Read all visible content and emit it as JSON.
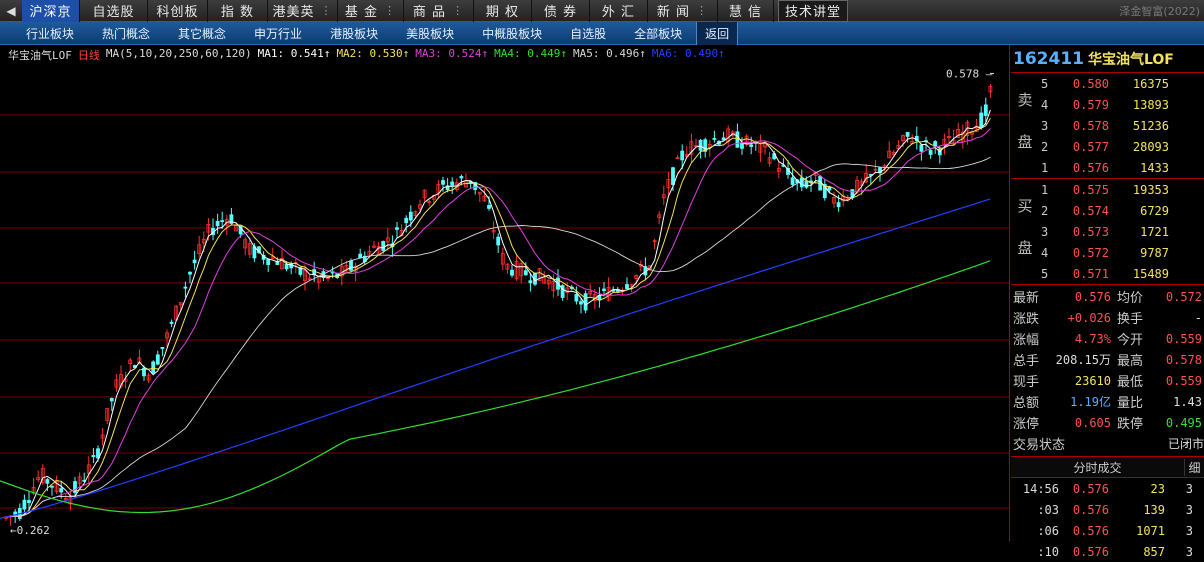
{
  "top_menu": {
    "active": "沪深京",
    "items": [
      "自选股",
      "科创板",
      "指 数",
      "港美英",
      "基 金",
      "商 品",
      "期 权",
      "债 券",
      "外 汇",
      "新 闻",
      "慧 信"
    ],
    "edu": "技术讲堂",
    "right_text": "泽金智富(2022)"
  },
  "sub_menu": {
    "items": [
      "行业板块",
      "热门概念",
      "其它概念",
      "申万行业",
      "港股板块",
      "美股板块",
      "中概股板块",
      "自选股",
      "全部板块"
    ],
    "back": "返回"
  },
  "legend": {
    "name": "华宝油气LOF",
    "period": "日线",
    "ma_params": "MA(5,10,20,250,60,120)",
    "ma1": "MA1: 0.541↑",
    "ma2": "MA2: 0.530↑",
    "ma3": "MA3: 0.524↑",
    "ma4": "MA4: 0.449↑",
    "ma5": "MA5: 0.496↑",
    "ma6": "MA6: 0.490↑"
  },
  "colors": {
    "up": "#ff3030",
    "down": "#54ffff",
    "ma1": "#ffffff",
    "ma2": "#f3e35a",
    "ma3": "#e040e0",
    "ma4": "#30e030",
    "ma5": "#d8d8d8",
    "ma6": "#2040ff",
    "grid": "#7a0000"
  },
  "chart_data": {
    "type": "candlestick",
    "y_range": [
      0.255,
      0.588
    ],
    "high_label": "0.578",
    "low_label": "0.262",
    "ma4_start": 0.296,
    "ma4_end": 0.449,
    "ma6_start": 0.27,
    "ma6_end": 0.49
  },
  "panel": {
    "code": "162411",
    "name": "华宝油气LOF",
    "sell_label": "卖盘",
    "buy_label": "买盘",
    "sell": [
      {
        "lv": "5",
        "price": "0.580",
        "vol": "16375"
      },
      {
        "lv": "4",
        "price": "0.579",
        "vol": "13893"
      },
      {
        "lv": "3",
        "price": "0.578",
        "vol": "51236"
      },
      {
        "lv": "2",
        "price": "0.577",
        "vol": "28093"
      },
      {
        "lv": "1",
        "price": "0.576",
        "vol": "1433"
      }
    ],
    "buy": [
      {
        "lv": "1",
        "price": "0.575",
        "vol": "19353"
      },
      {
        "lv": "2",
        "price": "0.574",
        "vol": "6729"
      },
      {
        "lv": "3",
        "price": "0.573",
        "vol": "1721"
      },
      {
        "lv": "4",
        "price": "0.572",
        "vol": "9787"
      },
      {
        "lv": "5",
        "price": "0.571",
        "vol": "15489"
      }
    ],
    "stats": [
      {
        "l1": "最新",
        "v1": "0.576",
        "c1": "red",
        "l2": "均价",
        "v2": "0.572",
        "c2": "red"
      },
      {
        "l1": "涨跌",
        "v1": "+0.026",
        "c1": "red",
        "l2": "换手",
        "v2": "-",
        "c2": "white"
      },
      {
        "l1": "涨幅",
        "v1": "4.73%",
        "c1": "red",
        "l2": "今开",
        "v2": "0.559",
        "c2": "red"
      },
      {
        "l1": "总手",
        "v1": "208.15万",
        "c1": "white",
        "l2": "最高",
        "v2": "0.578",
        "c2": "red"
      },
      {
        "l1": "现手",
        "v1": "23610",
        "c1": "yellow",
        "l2": "最低",
        "v2": "0.559",
        "c2": "red"
      },
      {
        "l1": "总额",
        "v1": "1.19亿",
        "c1": "cyan",
        "l2": "量比",
        "v2": "1.43",
        "c2": "white"
      },
      {
        "l1": "涨停",
        "v1": "0.605",
        "c1": "red",
        "l2": "跌停",
        "v2": "0.495",
        "c2": "green"
      },
      {
        "l1": "交易状态",
        "v1": "",
        "c1": "white",
        "l2": "",
        "v2": "已闭市",
        "c2": "white"
      }
    ],
    "trades_title": "分时成交",
    "trades_detail": "细",
    "trades": [
      {
        "t": "14:56",
        "p": "0.576",
        "v": "23",
        "n": "3"
      },
      {
        "t": ":03",
        "p": "0.576",
        "v": "139",
        "n": "3"
      },
      {
        "t": ":06",
        "p": "0.576",
        "v": "1071",
        "n": "3"
      },
      {
        "t": ":10",
        "p": "0.576",
        "v": "857",
        "n": "3"
      }
    ]
  }
}
